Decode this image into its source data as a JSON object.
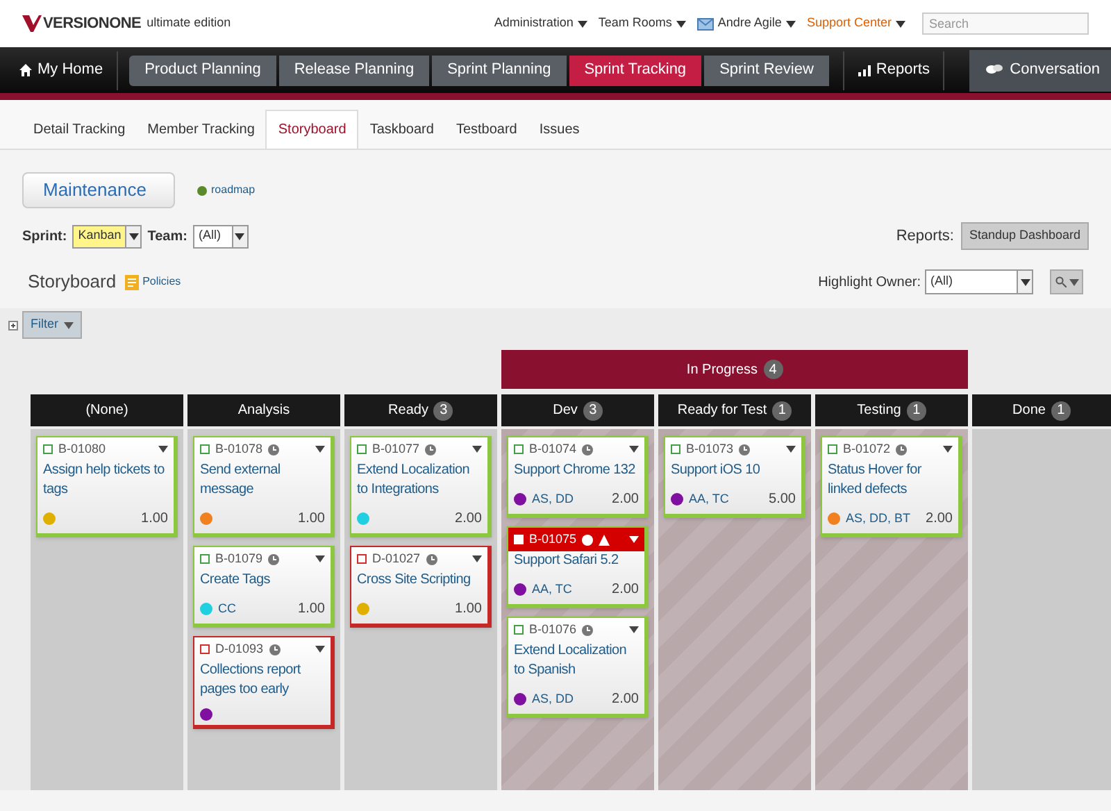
{
  "brand": {
    "name": "VERSIONONE",
    "edition": "ultimate edition"
  },
  "top_links": [
    {
      "label": "Administration",
      "kind": "menu"
    },
    {
      "label": "Team Rooms",
      "kind": "menu"
    },
    {
      "label": "Andre Agile",
      "kind": "user"
    },
    {
      "label": "Support Center",
      "kind": "support"
    }
  ],
  "search": {
    "placeholder": "Search"
  },
  "nav": [
    {
      "label": "My Home",
      "kind": "home",
      "selected": false
    },
    {
      "label": "Product Planning",
      "kind": "step",
      "selected": false
    },
    {
      "label": "Release Planning",
      "kind": "step",
      "selected": false
    },
    {
      "label": "Sprint Planning",
      "kind": "step",
      "selected": false
    },
    {
      "label": "Sprint Tracking",
      "kind": "step",
      "selected": true
    },
    {
      "label": "Sprint Review",
      "kind": "step",
      "selected": false
    },
    {
      "label": "Reports",
      "kind": "reports",
      "selected": false
    },
    {
      "label": "Conversation",
      "kind": "conversation",
      "selected": false
    }
  ],
  "tabs": [
    {
      "label": "Detail Tracking",
      "selected": false
    },
    {
      "label": "Member Tracking",
      "selected": false
    },
    {
      "label": "Storyboard",
      "selected": true
    },
    {
      "label": "Taskboard",
      "selected": false
    },
    {
      "label": "Testboard",
      "selected": false
    },
    {
      "label": "Issues",
      "selected": false
    }
  ],
  "project": {
    "label": "Maintenance",
    "link": "roadmap"
  },
  "filters": {
    "sprint_label": "Sprint:",
    "sprint": "Kanban",
    "team_label": "Team:",
    "team": "(All)",
    "reports_label": "Reports:",
    "report": "Standup Dashboard"
  },
  "board": {
    "title": "Storyboard",
    "policies": "Policies",
    "highlight_label": "Highlight Owner:",
    "highlight": "(All)",
    "filter": "Filter",
    "group": {
      "label": "In Progress",
      "count": "4"
    },
    "columns": [
      {
        "name": "(None)",
        "in_progress": false,
        "cards": [
          {
            "id": "B-01080",
            "kind": "story",
            "blocked": false,
            "clock": false,
            "title": "Assign help tickets to tags",
            "color": "#e0b000",
            "estimate": "1.00"
          }
        ]
      },
      {
        "name": "Analysis",
        "in_progress": false,
        "cards": [
          {
            "id": "B-01078",
            "kind": "story",
            "blocked": false,
            "clock": true,
            "title": "Send external message",
            "color": "#f08020",
            "estimate": "1.00"
          },
          {
            "id": "B-01079",
            "kind": "story",
            "blocked": false,
            "clock": true,
            "title": "Create Tags",
            "color": "#20d0e0",
            "owners": "CC",
            "estimate": "1.00"
          },
          {
            "id": "D-01093",
            "kind": "defect",
            "blocked": false,
            "clock": true,
            "title": "Collections report pages too early",
            "color": "#8010a0"
          }
        ]
      },
      {
        "name": "Ready",
        "count": "3",
        "in_progress": false,
        "cards": [
          {
            "id": "B-01077",
            "kind": "story",
            "blocked": false,
            "clock": true,
            "title": "Extend Localization to Integrations",
            "color": "#20d0e0",
            "estimate": "2.00"
          },
          {
            "id": "D-01027",
            "kind": "defect",
            "blocked": false,
            "clock": true,
            "title": "Cross Site Scripting",
            "color": "#e0b000",
            "estimate": "1.00"
          }
        ]
      },
      {
        "name": "Dev",
        "count": "3",
        "in_progress": true,
        "cards": [
          {
            "id": "B-01074",
            "kind": "story",
            "blocked": false,
            "clock": true,
            "title": "Support Chrome 132",
            "color": "#8010a0",
            "owners": "AS, DD",
            "estimate": "2.00"
          },
          {
            "id": "B-01075",
            "kind": "story",
            "blocked": true,
            "clock": true,
            "title": "Support Safari 5.2",
            "color": "#8010a0",
            "owners": "AA, TC",
            "estimate": "2.00"
          },
          {
            "id": "B-01076",
            "kind": "story",
            "blocked": false,
            "clock": true,
            "title": "Extend Localization to Spanish",
            "color": "#8010a0",
            "owners": "AS, DD",
            "estimate": "2.00"
          }
        ]
      },
      {
        "name": "Ready for Test",
        "count": "1",
        "in_progress": true,
        "cards": [
          {
            "id": "B-01073",
            "kind": "story",
            "blocked": false,
            "clock": true,
            "title": "Support iOS 10",
            "color": "#8010a0",
            "owners": "AA, TC",
            "estimate": "5.00"
          }
        ]
      },
      {
        "name": "Testing",
        "count": "1",
        "in_progress": true,
        "cards": [
          {
            "id": "B-01072",
            "kind": "story",
            "blocked": false,
            "clock": true,
            "title": "Status Hover for linked defects",
            "color": "#f08020",
            "owners": "AS, DD, BT",
            "estimate": "2.00"
          }
        ]
      },
      {
        "name": "Done",
        "count": "1",
        "in_progress": false
      }
    ]
  }
}
